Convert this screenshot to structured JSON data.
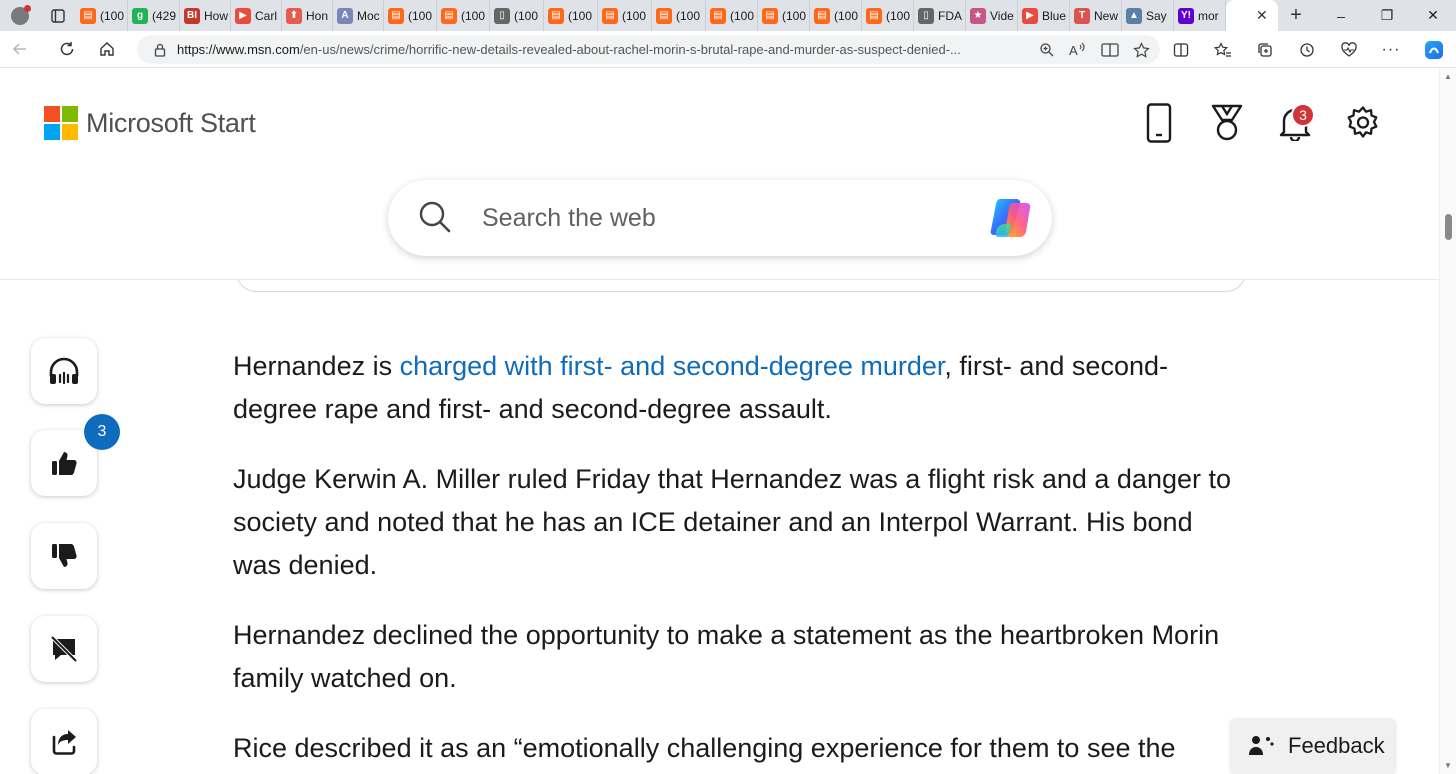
{
  "browser": {
    "tabs": [
      {
        "label": "(100",
        "favicon": "substack-icon",
        "color": "#ff6719"
      },
      {
        "label": "(429",
        "favicon": "g-icon",
        "color": "#21b356"
      },
      {
        "label": "How",
        "favicon": "bi-icon",
        "color": "#c0392b"
      },
      {
        "label": "Carl",
        "favicon": "video-icon",
        "color": "#e74c3c"
      },
      {
        "label": "Hon",
        "favicon": "upload-icon",
        "color": "#e55b4d"
      },
      {
        "label": "Moc",
        "favicon": "a-icon",
        "color": "#7a86b8"
      },
      {
        "label": "(100",
        "favicon": "substack-icon",
        "color": "#ff6719"
      },
      {
        "label": "(100",
        "favicon": "substack-icon",
        "color": "#ff6719"
      },
      {
        "label": "(100",
        "favicon": "page-icon",
        "color": "#666666"
      },
      {
        "label": "(100",
        "favicon": "substack-icon",
        "color": "#ff6719"
      },
      {
        "label": "(100",
        "favicon": "substack-icon",
        "color": "#ff6719"
      },
      {
        "label": "(100",
        "favicon": "substack-icon",
        "color": "#ff6719"
      },
      {
        "label": "(100",
        "favicon": "substack-icon",
        "color": "#ff6719"
      },
      {
        "label": "(100",
        "favicon": "substack-icon",
        "color": "#ff6719"
      },
      {
        "label": "(100",
        "favicon": "substack-icon",
        "color": "#ff6719"
      },
      {
        "label": "(100",
        "favicon": "substack-icon",
        "color": "#ff6719"
      },
      {
        "label": "FDA",
        "favicon": "page-icon",
        "color": "#666666"
      },
      {
        "label": "Vide",
        "favicon": "star-icon",
        "color": "#c4568a"
      },
      {
        "label": "Blue",
        "favicon": "video-icon",
        "color": "#e74c3c"
      },
      {
        "label": "New",
        "favicon": "t-icon",
        "color": "#d9534f"
      },
      {
        "label": "Say",
        "favicon": "image-icon",
        "color": "#5b7fa6"
      },
      {
        "label": "mor",
        "favicon": "yahoo-icon",
        "color": "#5f01d1"
      }
    ],
    "active_tab_favicon": "microsoft-icon",
    "url_host": "https://www.msn.com",
    "url_path": "/en-us/news/crime/horrific-new-details-revealed-about-rachel-morin-s-brutal-rape-and-murder-as-suspect-denied-..."
  },
  "header": {
    "brand": "Microsoft Start",
    "notifications_count": "3",
    "search_placeholder": "Search the web"
  },
  "rail": {
    "likes_count": "3"
  },
  "article": {
    "p1_before": "Hernandez is ",
    "p1_link": "charged with first- and second-degree murder",
    "p1_after": ", first- and second-degree rape and first- and second-degree assault.",
    "p2": "Judge Kerwin A. Miller ruled Friday that Hernandez was a flight risk and a danger to society and noted that he has an ICE detainer and an Interpol Warrant. His bond was denied.",
    "p3": "Hernandez declined the opportunity to make a statement as the heartbroken Morin family watched on.",
    "p4": "Rice described it as an “emotionally challenging experience for them to see the"
  },
  "feedback": {
    "label": "Feedback"
  },
  "colors": {
    "link": "#0f6cbd",
    "badge_blue": "#0f6cbd",
    "badge_red": "#d13438"
  }
}
